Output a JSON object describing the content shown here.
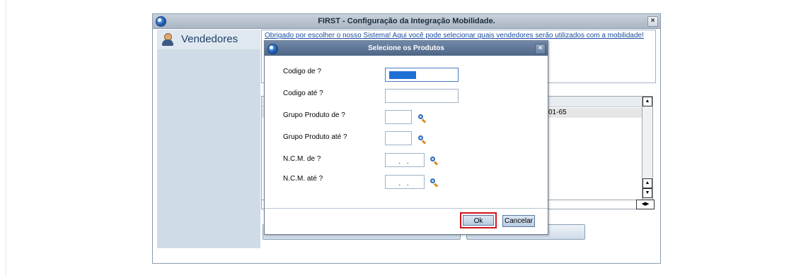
{
  "window": {
    "title": "FIRST - Configuração da Integração Mobilidade.",
    "close_glyph": "×"
  },
  "sidebar": {
    "title": "Vendedores",
    "icon": "user-icon"
  },
  "info": {
    "text": "Obrigado por escolher o nosso Sistema! Aqui você pode selecionar quais vendedores serão utilizados com a mobilidade!"
  },
  "grid": {
    "visible_cell": "01-65"
  },
  "dialog": {
    "title": "Selecione os Produtos",
    "close_glyph": "×",
    "fields": [
      {
        "label": "Codigo de ?",
        "value": ""
      },
      {
        "label": "Codigo até ?",
        "value": ""
      },
      {
        "label": "Grupo Produto de ?",
        "value": ""
      },
      {
        "label": "Grupo Produto até ?",
        "value": ""
      },
      {
        "label": "N.C.M. de ?",
        "value": ". ."
      },
      {
        "label": "N.C.M. até ?",
        "value": ". ."
      }
    ],
    "ok_label": "Ok",
    "cancel_label": "Cancelar"
  },
  "colors": {
    "highlight_border": "#d1141c",
    "selection": "#1f6fd6"
  }
}
